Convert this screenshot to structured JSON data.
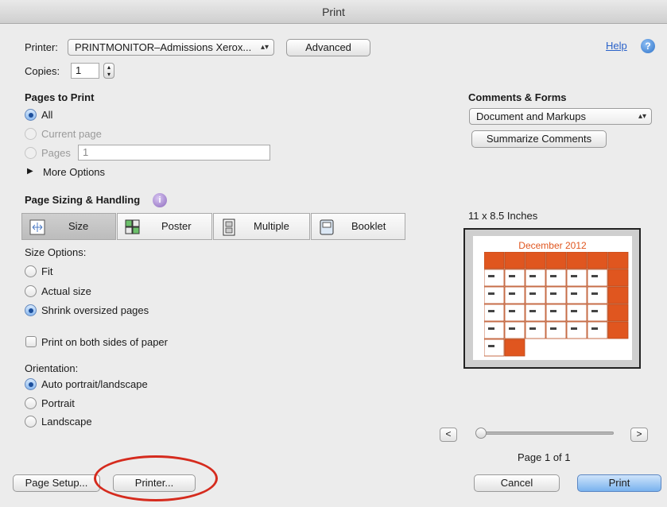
{
  "window": {
    "title": "Print"
  },
  "printer": {
    "label": "Printer:",
    "value": "PRINTMONITOR–Admissions Xerox...",
    "advanced_label": "Advanced"
  },
  "help": {
    "label": "Help",
    "icon": "?"
  },
  "copies": {
    "label": "Copies:",
    "value": "1"
  },
  "pages_to_print": {
    "heading": "Pages to Print",
    "options": [
      "All",
      "Current page",
      "Pages"
    ],
    "selected": "All",
    "pages_value": "1",
    "more_options": "More Options"
  },
  "comments_forms": {
    "heading": "Comments & Forms",
    "value": "Document and Markups",
    "summarize_label": "Summarize Comments"
  },
  "sizing": {
    "heading": "Page Sizing & Handling",
    "info_icon": "i",
    "segments": [
      "Size",
      "Poster",
      "Multiple",
      "Booklet"
    ],
    "selected": "Size"
  },
  "size_options": {
    "label": "Size Options:",
    "options": [
      "Fit",
      "Actual size",
      "Shrink oversized pages"
    ],
    "selected": "Shrink oversized pages"
  },
  "duplex": {
    "label": "Print on both sides of paper",
    "checked": false
  },
  "orientation": {
    "label": "Orientation:",
    "options": [
      "Auto portrait/landscape",
      "Portrait",
      "Landscape"
    ],
    "selected": "Auto portrait/landscape"
  },
  "preview": {
    "paper_size": "11 x 8.5 Inches",
    "calendar_title": "December 2012",
    "accent_color": "#e0561f",
    "page_indicator": "Page 1 of 1",
    "prev_label": "<",
    "next_label": ">"
  },
  "footer": {
    "page_setup_label": "Page Setup...",
    "printer_button_label": "Printer...",
    "cancel_label": "Cancel",
    "print_label": "Print",
    "annotation_color": "#d52b1e"
  }
}
